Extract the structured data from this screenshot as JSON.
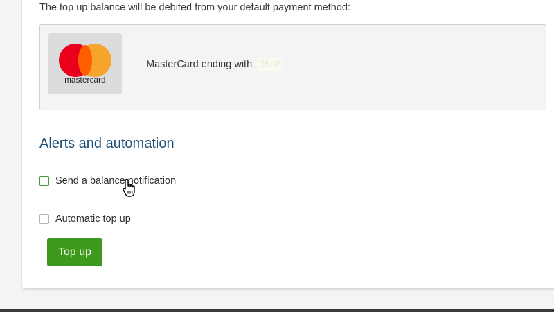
{
  "payment": {
    "debit_notice": "The top up balance will be debited from your default payment method:",
    "card_brand_wordmark": "mastercard",
    "card_label": "MasterCard ending with",
    "card_digits": "3548",
    "brand_colors": {
      "red": "#eb001b",
      "orange": "#f79e1b",
      "overlap": "#ff5f00"
    }
  },
  "alerts": {
    "title": "Alerts and automation",
    "balance_notification_label": "Send a balance notification",
    "balance_notification_checked": false,
    "automatic_topup_label": "Automatic top up",
    "automatic_topup_checked": false
  },
  "actions": {
    "topup_label": "Top up"
  },
  "icons": {
    "cursor": "hand-pointer-icon"
  },
  "colors": {
    "accent_green": "#3d9a1c",
    "title_blue": "#1d4f78"
  }
}
